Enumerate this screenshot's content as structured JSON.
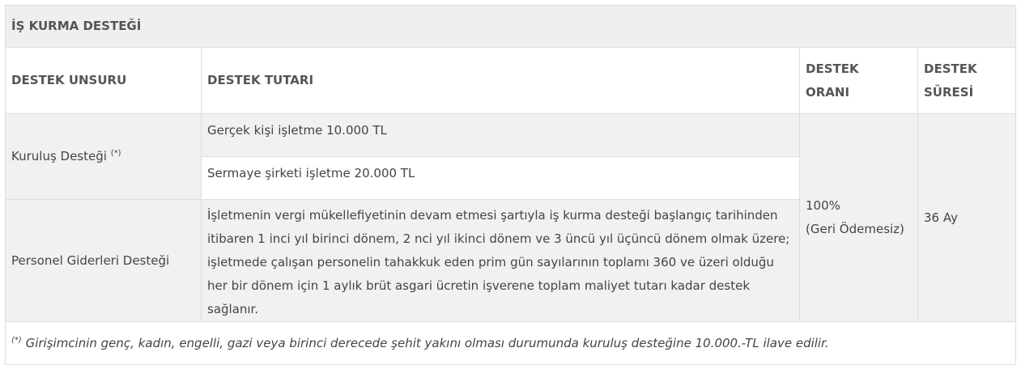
{
  "table": {
    "title": "İŞ KURMA DESTEĞİ",
    "headers": {
      "unsur": "DESTEK UNSURU",
      "tutar": "DESTEK TUTARI",
      "oran_line1": "DESTEK",
      "oran_line2": "ORANI",
      "sure_line1": "DESTEK",
      "sure_line2": "SÜRESİ"
    },
    "rows": {
      "kurulus_label": "Kuruluş Desteği",
      "kurulus_mark": "(*)",
      "kurulus_amount_1": "Gerçek kişi işletme 10.000 TL",
      "kurulus_amount_2": "Sermaye şirketi işletme 20.000 TL",
      "personel_label": "Personel Giderleri Desteği",
      "personel_amount": "İşletmenin vergi mükellefiyetinin devam etmesi şartıyla iş kurma desteği başlangıç tarihinden itibaren 1 inci yıl birinci dönem, 2 nci yıl ikinci dönem ve 3 üncü yıl üçüncü dönem olmak üzere; işletmede çalışan personelin tahakkuk eden prim gün sayılarının toplamı 360 ve üzeri olduğu her bir dönem için 1 aylık brüt asgari ücretin işverene toplam maliyet tutarı kadar destek sağlanır.",
      "oran_line1": "100%",
      "oran_line2": "(Geri Ödemesiz)",
      "sure": "36 Ay"
    },
    "footnote": {
      "mark": "(*)",
      "text": " Girişimcinin genç, kadın, engelli, gazi veya birinci derecede şehit yakını olması durumunda kuruluş desteğine 10.000.-TL ilave edilir."
    }
  }
}
